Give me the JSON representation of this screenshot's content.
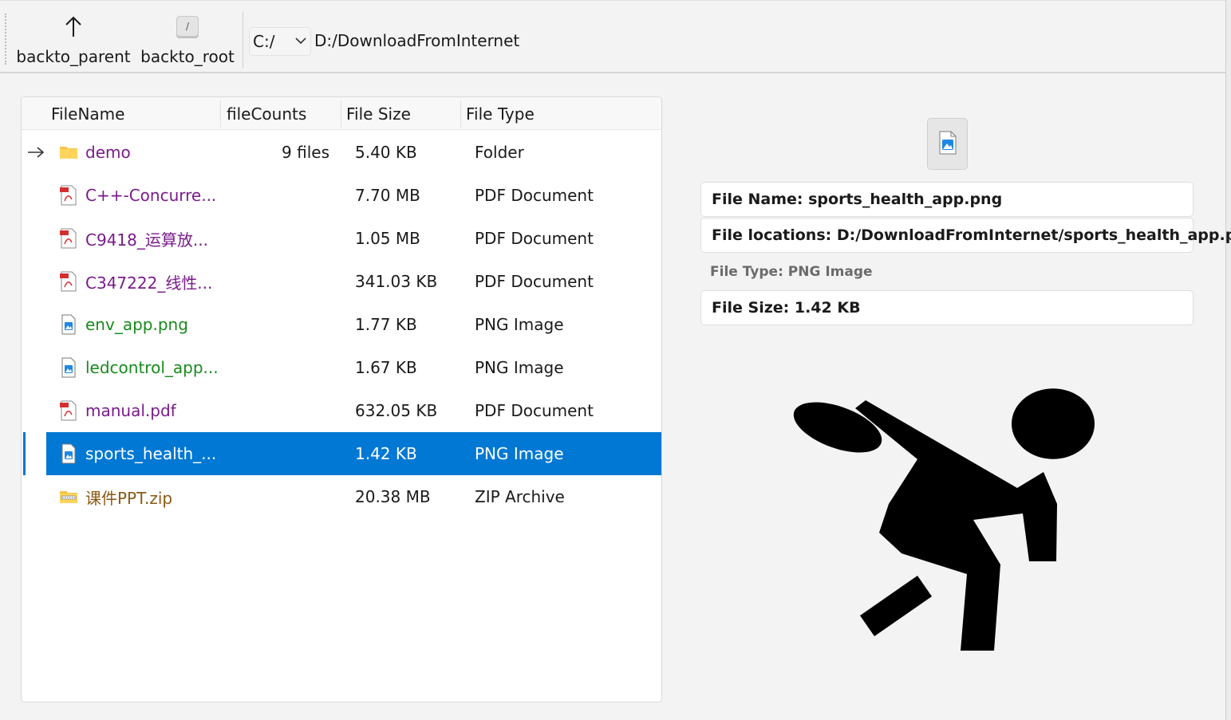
{
  "toolbar": {
    "back_parent_label": "backto_parent",
    "back_root_label": "backto_root",
    "back_root_icon_glyph": "/",
    "drive_value": "C:/",
    "current_path": "D:/DownloadFromInternet"
  },
  "table": {
    "headers": [
      "FileName",
      "fileCounts",
      "File Size",
      "File Type"
    ],
    "rows": [
      {
        "name": "demo",
        "count": "9 files",
        "size": "5.40 KB",
        "type": "Folder",
        "icon": "folder-icon",
        "color": "#7a1b8c",
        "current": true
      },
      {
        "name": "C++-Concurre...",
        "count": "",
        "size": "7.70 MB",
        "type": "PDF Document",
        "icon": "pdf-icon",
        "color": "#7a1b8c"
      },
      {
        "name": "C9418_运算放...",
        "count": "",
        "size": "1.05 MB",
        "type": "PDF Document",
        "icon": "pdf-icon",
        "color": "#7a1b8c"
      },
      {
        "name": "C347222_线性...",
        "count": "",
        "size": "341.03 KB",
        "type": "PDF Document",
        "icon": "pdf-icon",
        "color": "#7a1b8c"
      },
      {
        "name": "env_app.png",
        "count": "",
        "size": "1.77 KB",
        "type": "PNG Image",
        "icon": "image-file-icon",
        "color": "#178a1c"
      },
      {
        "name": "ledcontrol_app...",
        "count": "",
        "size": "1.67 KB",
        "type": "PNG Image",
        "icon": "image-file-icon",
        "color": "#178a1c"
      },
      {
        "name": "manual.pdf",
        "count": "",
        "size": "632.05 KB",
        "type": "PDF Document",
        "icon": "pdf-icon",
        "color": "#7a1b8c"
      },
      {
        "name": "sports_health_...",
        "count": "",
        "size": "1.42 KB",
        "type": "PNG Image",
        "icon": "image-file-icon",
        "color": "#178a1c",
        "selected": true
      },
      {
        "name": "课件PPT.zip",
        "count": "",
        "size": "20.38 MB",
        "type": "ZIP Archive",
        "icon": "zip-icon",
        "color": "#8a5a14"
      }
    ]
  },
  "details": {
    "file_name": "File Name: sports_health_app.png",
    "file_location": "File locations: D:/DownloadFromInternet/sports_health_app.png",
    "file_type": "File Type: PNG Image",
    "file_size": "File Size: 1.42 KB"
  },
  "colors": {
    "selection": "#0078d4",
    "pdf_text": "#7a1b8c",
    "png_text": "#178a1c",
    "zip_text": "#8a5a14"
  }
}
